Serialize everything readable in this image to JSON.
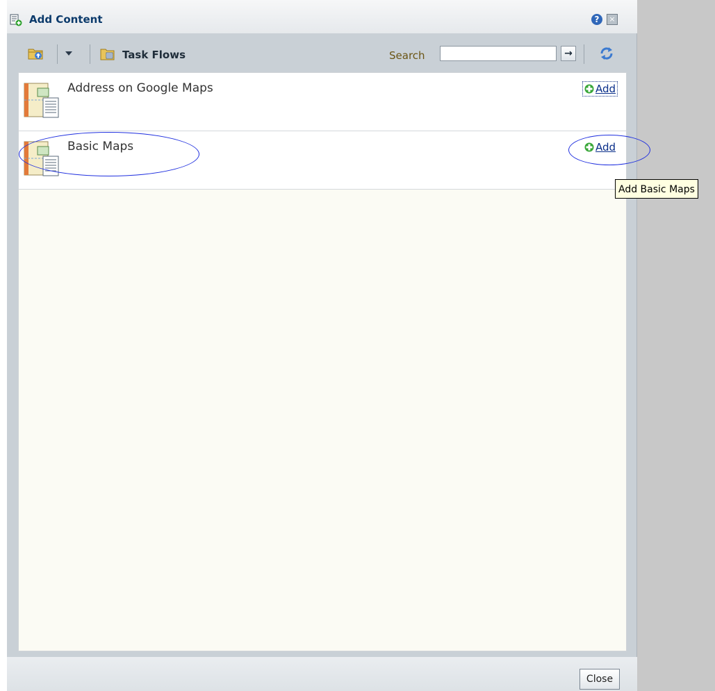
{
  "dialog": {
    "title": "Add Content",
    "icons": {
      "title": "add-content-icon",
      "help": "help-icon",
      "close": "close-icon"
    },
    "help_glyph": "?",
    "close_glyph": "×"
  },
  "toolbar": {
    "folder_icon": "folder-up-icon",
    "dropdown_icon": "chevron-down-icon",
    "taskflow_icon": "task-flows-icon",
    "taskflow_label": "Task Flows",
    "search_label": "Search",
    "search_value": "",
    "search_go_glyph": "→",
    "refresh_icon": "refresh-icon"
  },
  "items": [
    {
      "title": "Address on Google Maps",
      "add_label": "Add",
      "icon": "task-flow-item-icon",
      "focused": true
    },
    {
      "title": "Basic Maps",
      "add_label": "Add",
      "icon": "task-flow-item-icon",
      "focused": false
    }
  ],
  "tooltip": {
    "text": "Add Basic Maps"
  },
  "footer": {
    "close_label": "Close"
  },
  "colors": {
    "accent_link": "#0a2f8a",
    "annotation": "#1f2fdf",
    "tooltip_bg": "#ffffe1"
  }
}
